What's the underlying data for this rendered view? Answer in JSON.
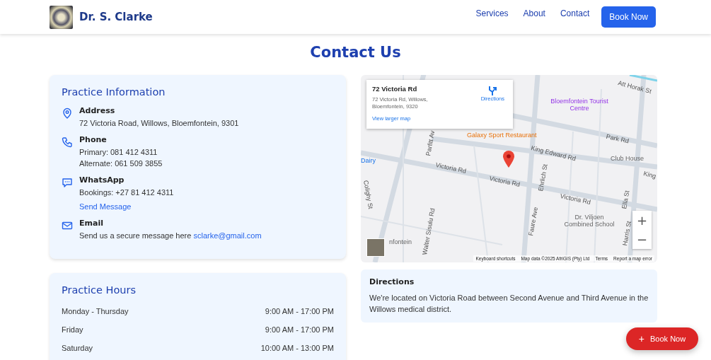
{
  "header": {
    "brand": "Dr. S. Clarke",
    "nav": [
      {
        "label": "Services",
        "kind": "link"
      },
      {
        "label": "About",
        "kind": "link"
      },
      {
        "label": "Contact",
        "kind": "link"
      },
      {
        "label": "Book Now",
        "kind": "button"
      }
    ]
  },
  "title": "Contact Us",
  "practice_info": {
    "heading": "Practice Information",
    "items": [
      {
        "kind": "address",
        "label": "Address",
        "lines": [
          "72 Victoria Road, Willows, Bloemfontein, 9301"
        ]
      },
      {
        "kind": "phone",
        "label": "Phone",
        "lines": [
          "Primary: 081 412 4311",
          "Alternate: 061 509 3855"
        ]
      },
      {
        "kind": "whatsapp",
        "label": "WhatsApp",
        "lines": [
          "Bookings: +27 81 412 4311"
        ],
        "link": "Send Message"
      },
      {
        "kind": "email",
        "label": "Email",
        "lines": [
          "Send us a secure message here"
        ],
        "inline_link": "sclarke@gmail.com"
      }
    ]
  },
  "practice_hours": {
    "heading": "Practice Hours",
    "rows": [
      {
        "day": "Monday - Thursday",
        "time": "9:00 AM - 17:00 PM"
      },
      {
        "day": "Friday",
        "time": "9:00 AM - 17:00 PM"
      },
      {
        "day": "Saturday",
        "time": "10:00 AM - 13:00 PM"
      }
    ]
  },
  "map": {
    "card": {
      "title": "72 Victoria Rd",
      "address": "72 Victoria Rd, Willows, Bloemfontein, 9320",
      "directions": "Directions",
      "larger_map": "View larger map"
    },
    "labels": [
      {
        "text": "Att Horak St",
        "kind": "street"
      },
      {
        "text": "Bloemfontein Tourist Centre",
        "kind": "poi-purple"
      },
      {
        "text": "Galaxy Sport Restaurant",
        "kind": "poi-orange"
      },
      {
        "text": "Park Rd",
        "kind": "street"
      },
      {
        "text": "King Edward Rd",
        "kind": "street"
      },
      {
        "text": "Club House",
        "kind": "poi"
      },
      {
        "text": "King",
        "kind": "street"
      },
      {
        "text": "Dairy",
        "kind": "poi-blue"
      },
      {
        "text": "Victoria Rd",
        "kind": "street"
      },
      {
        "text": "Victoria Rd",
        "kind": "street"
      },
      {
        "text": "Victoria Rd",
        "kind": "street"
      },
      {
        "text": "Colighy St",
        "kind": "street"
      },
      {
        "text": "Walter Sisulu Rd",
        "kind": "street"
      },
      {
        "text": "Parfitt Av",
        "kind": "street"
      },
      {
        "text": "Ehrlich St",
        "kind": "street"
      },
      {
        "text": "Faure Ave",
        "kind": "street"
      },
      {
        "text": "Ella St",
        "kind": "street"
      },
      {
        "text": "Harris St",
        "kind": "street"
      },
      {
        "text": "Dr. Viljoen Combined School",
        "kind": "poi"
      },
      {
        "text": "nfontein",
        "kind": "poi"
      }
    ],
    "attribution": [
      "Keyboard shortcuts",
      "Map data ©2025 AfriGIS (Pty) Ltd",
      "Terms",
      "Report a map error"
    ],
    "zoom": [
      "+",
      "−"
    ]
  },
  "directions": {
    "heading": "Directions",
    "text": "We're located on Victoria Road between Second Avenue and Third Avenue in the Willows medical district."
  },
  "fab": {
    "icon": "+",
    "label": "Book Now"
  }
}
